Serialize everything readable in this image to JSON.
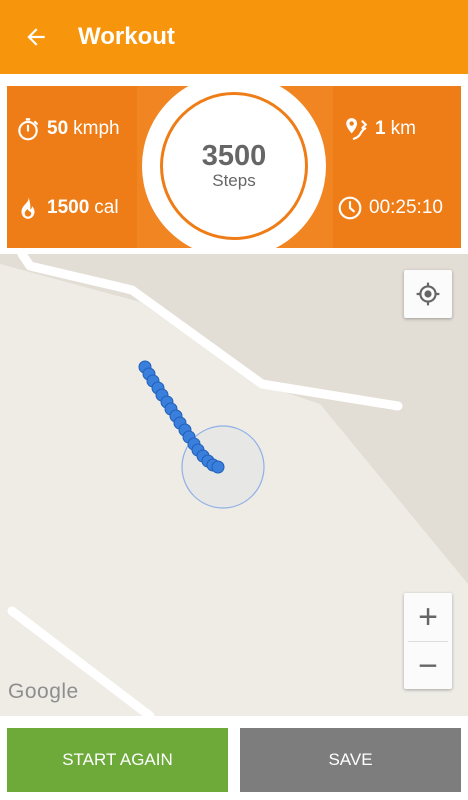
{
  "appbar": {
    "title": "Workout",
    "back_icon": "arrow-left-icon"
  },
  "stats": {
    "speed": {
      "value": "50",
      "unit": "kmph",
      "icon": "stopwatch-icon"
    },
    "distance": {
      "value": "1",
      "unit": "km",
      "icon": "route-pin-icon"
    },
    "calories": {
      "value": "1500",
      "unit": "cal",
      "icon": "flame-icon"
    },
    "duration": {
      "value": "00:25:10",
      "icon": "clock-icon"
    },
    "steps": {
      "value": "3500",
      "label": "Steps"
    }
  },
  "map": {
    "attribution": "Google",
    "zoom_in_label": "+",
    "zoom_out_label": "−",
    "my_location_icon": "crosshair-icon"
  },
  "actions": {
    "start_again": "START AGAIN",
    "save": "SAVE"
  },
  "colors": {
    "appbar": "#f7950c",
    "stats_background": "#ef7d17",
    "start_button": "#6daa3a",
    "save_button": "#7d7d7d",
    "track": "#3b7fdd"
  }
}
